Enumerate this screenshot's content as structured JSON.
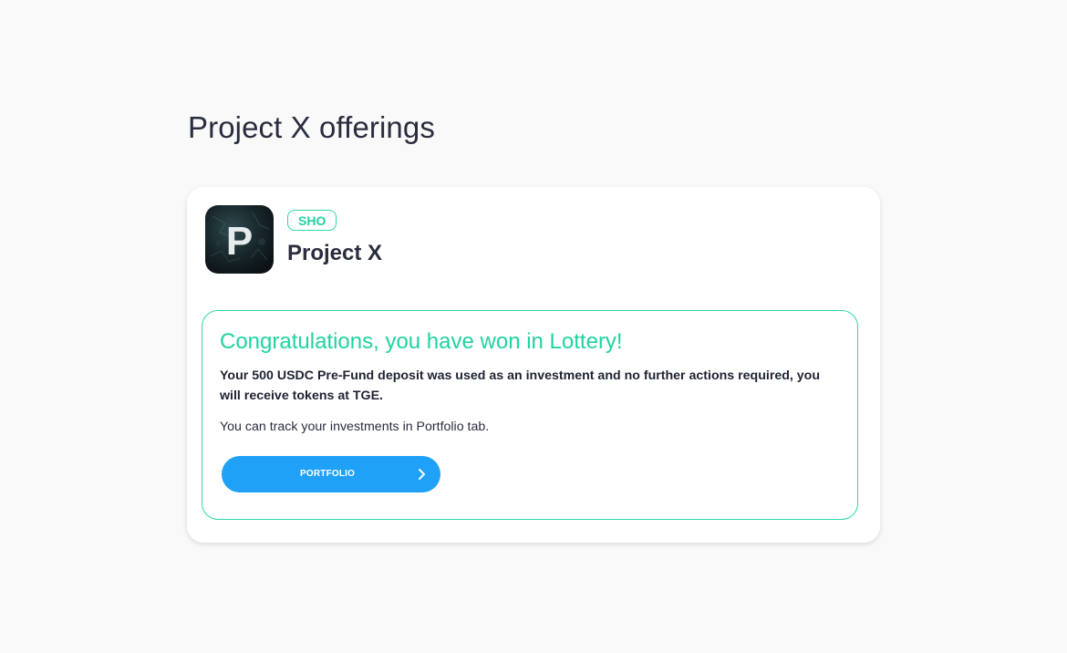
{
  "page": {
    "title": "Project X offerings"
  },
  "offering": {
    "badge": "SHO",
    "name": "Project X",
    "logo_letter": "P",
    "result": {
      "title": "Congratulations, you have won in Lottery!",
      "message": "Your 500 USDC Pre-Fund deposit was used as an investment and no further actions required, you will receive tokens at TGE.",
      "note": "You can track your investments in Portfolio tab.",
      "button_label": "PORTFOLIO",
      "button_icon": "chevron-right-icon"
    }
  },
  "colors": {
    "accent_green": "#20d3a0",
    "button_blue": "#1ea1f7",
    "text_dark": "#2a2d3e"
  }
}
